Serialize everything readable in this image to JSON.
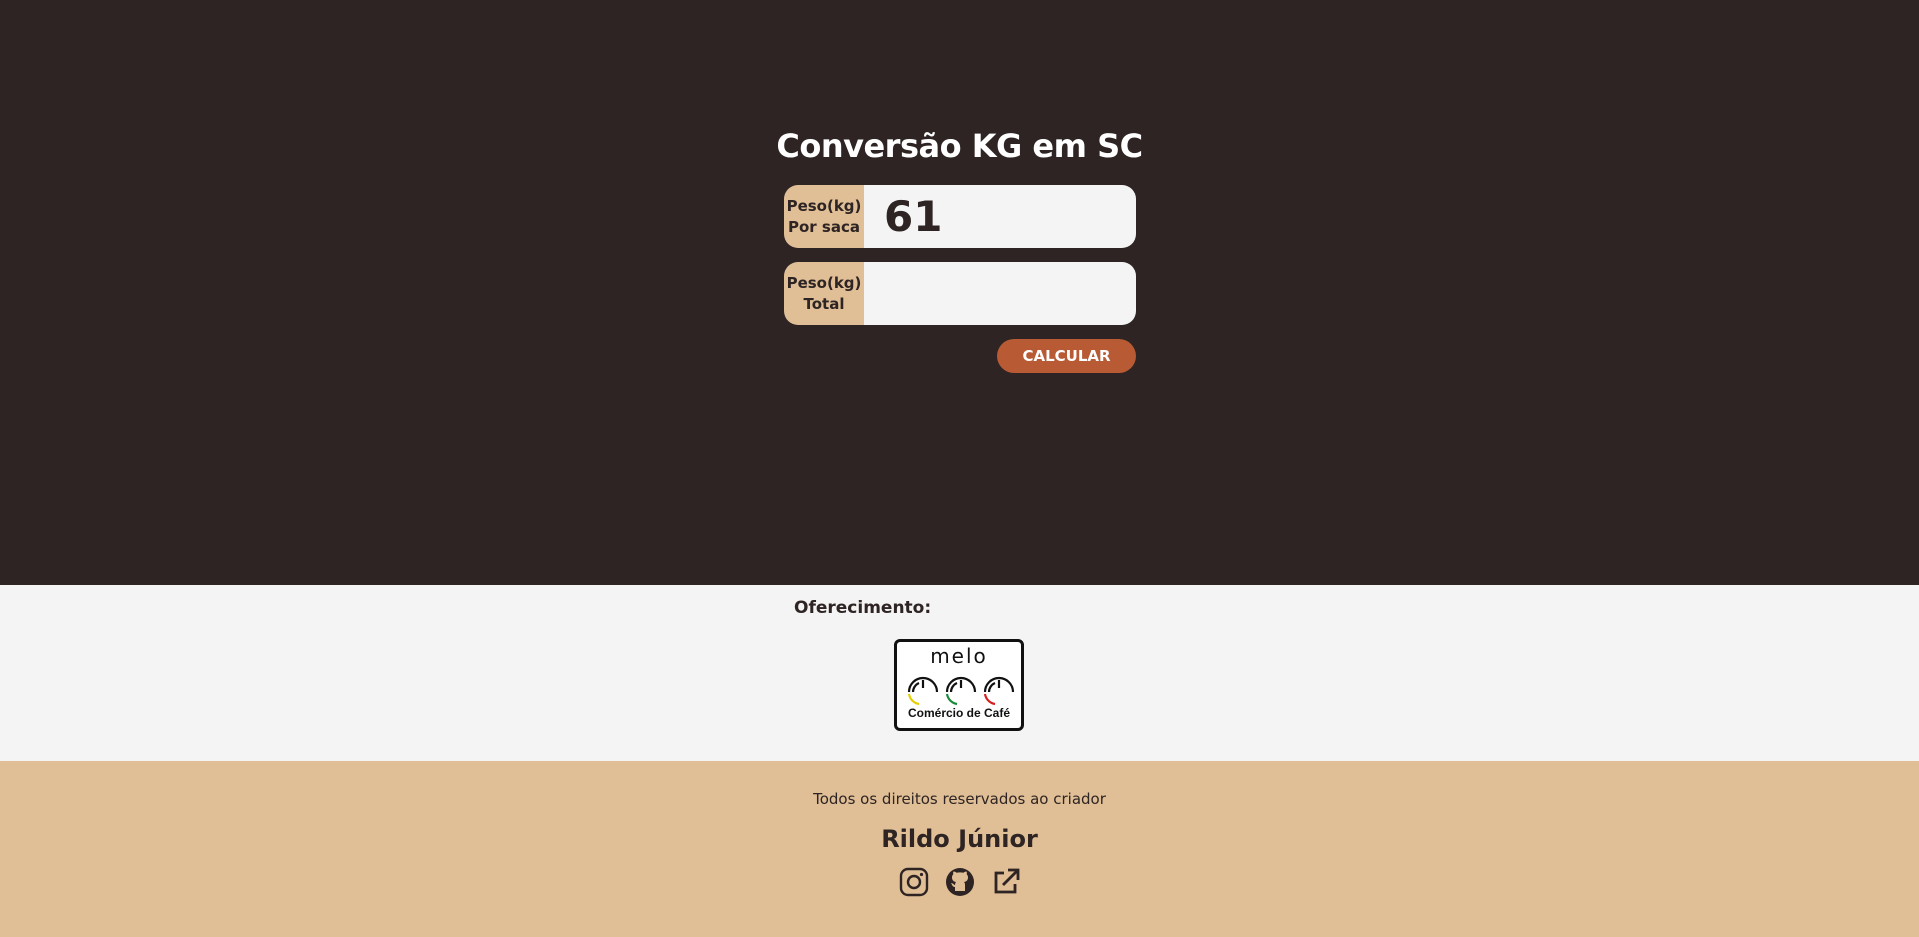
{
  "main": {
    "title": "Conversão KG em SC",
    "fields": [
      {
        "label_line1": "Peso(kg)",
        "label_line2": "Por saca",
        "value": "61",
        "placeholder": ""
      },
      {
        "label_line1": "Peso(kg)",
        "label_line2": "Total",
        "value": "",
        "placeholder": ""
      }
    ],
    "calculate_label": "CALCULAR"
  },
  "sponsor": {
    "label": "Oferecimento:",
    "logo_word": "melo",
    "logo_caption": "Comércio de Café"
  },
  "footer": {
    "rights": "Todos os direitos reservados ao criador",
    "author": "Rildo Júnior",
    "social_icons": [
      "instagram-icon",
      "github-icon",
      "external-link-icon"
    ]
  },
  "colors": {
    "background_dark": "#2d2423",
    "accent_tan": "#e0bf96",
    "button": "#b85a34",
    "light": "#f4f4f4"
  }
}
